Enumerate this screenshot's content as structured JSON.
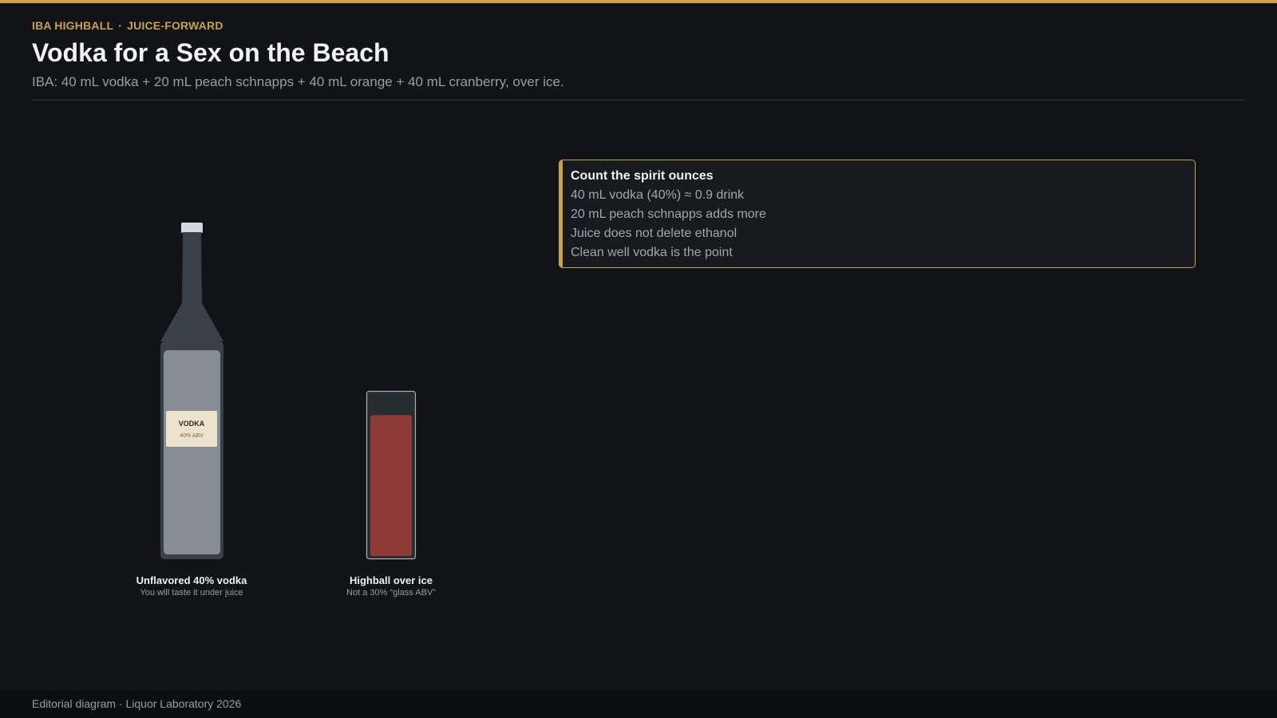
{
  "header": {
    "kicker_left": "IBA HIGHBALL",
    "kicker_sep": "·",
    "kicker_right": "JUICE-FORWARD",
    "title": "Vodka for a Sex on the Beach",
    "subtitle": "IBA: 40 mL vodka + 20 mL peach schnapps + 40 mL orange + 40 mL cranberry, over ice."
  },
  "bottle": {
    "label_title": "VODKA",
    "label_abv": "40% ABV",
    "caption": "Unflavored 40% vodka",
    "caption_sub": "You will taste it under juice"
  },
  "glass": {
    "caption": "Highball over ice",
    "caption_sub": "Not a 30% “glass ABV”",
    "fill_fraction": 0.87
  },
  "note": {
    "title": "Count the spirit ounces",
    "lines": [
      "40 mL vodka (40%) ≈ 0.9 drink",
      "20 mL peach schnapps adds more",
      "Juice does not delete ethanol",
      "Clean well vodka is the point"
    ]
  },
  "footer": {
    "text": "Editorial diagram · Liquor Laboratory 2026"
  },
  "colors": {
    "accent": "#c9a24e",
    "background": "#111316",
    "bottle_glass": "#3a4048",
    "bottle_liquid": "#878d94",
    "label": "#ede3cc",
    "juice": "#8e3a35"
  }
}
